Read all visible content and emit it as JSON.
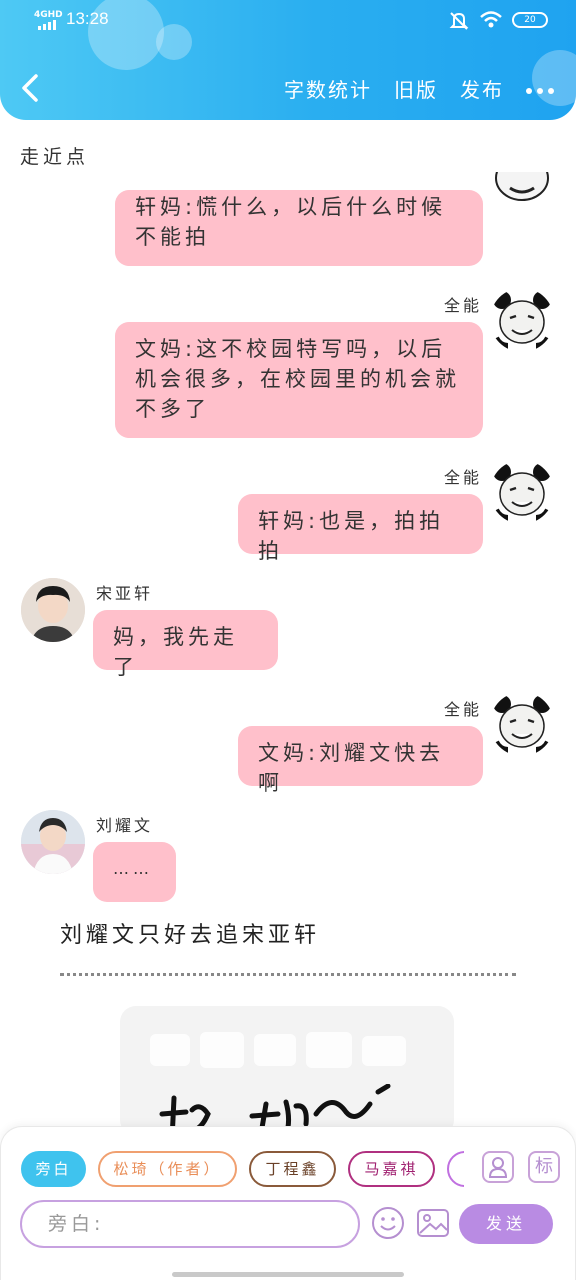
{
  "status_bar": {
    "network": "4GHD",
    "time": "13:28",
    "battery": "20"
  },
  "nav": {
    "back": "back",
    "word_count": "字数统计",
    "old_version": "旧版",
    "publish": "发布"
  },
  "chapter_title": "走近点",
  "messages": [
    {
      "side": "right",
      "text": "轩妈:慌什么，以后什么时候不能拍"
    },
    {
      "side": "right",
      "name": "全能",
      "text": "文妈:这不校园特写吗，以后机会很多，在校园里的机会就不多了"
    },
    {
      "side": "right",
      "name": "全能",
      "text": "轩妈:也是，拍拍拍"
    },
    {
      "side": "left",
      "name": "宋亚轩",
      "text": "妈，我先走了"
    },
    {
      "side": "right",
      "name": "全能",
      "text": "文妈:刘耀文快去啊"
    },
    {
      "side": "left",
      "name": "刘耀文",
      "text": "……"
    }
  ],
  "narration": "刘耀文只好去追宋亚轩",
  "roles": [
    {
      "label": "旁白",
      "color": "#3fc3ee"
    },
    {
      "label": "松琦（作者）",
      "color": "#f0a070"
    },
    {
      "label": "丁程鑫",
      "color": "#8a5a3a"
    },
    {
      "label": "马嘉祺",
      "color": "#b03080"
    }
  ],
  "input": {
    "placeholder": "旁白:"
  },
  "send_label": "发送",
  "tag_label": "标",
  "colors": {
    "header": "#2aaef0",
    "bubble": "#ffc0cb",
    "send": "#b98be3"
  }
}
